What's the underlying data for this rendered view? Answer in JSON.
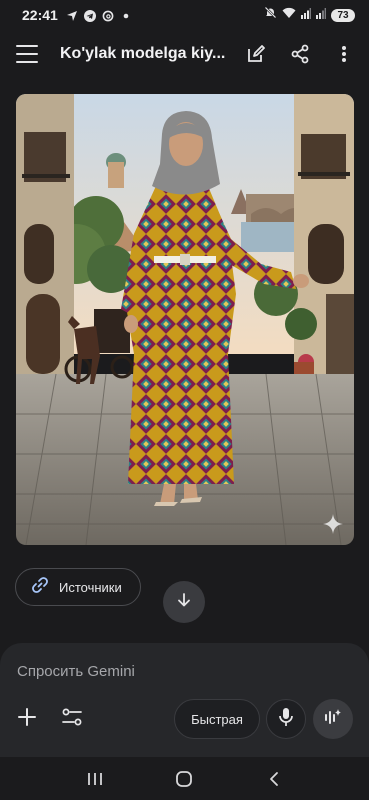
{
  "status_bar": {
    "time": "22:41",
    "battery": "73",
    "left_icons": [
      "location-arrow-icon",
      "telegram-icon",
      "threads-icon",
      "dot-icon"
    ],
    "right_icons": [
      "mute-icon",
      "wifi-icon",
      "signal-icon",
      "signal-icon",
      "battery-icon"
    ]
  },
  "app_bar": {
    "title": "Ko'ylak modelga kiy...",
    "icons": [
      "menu-icon",
      "edit-icon",
      "share-icon",
      "more-vert-icon"
    ]
  },
  "image": {
    "description_icon": "sparkle-icon"
  },
  "sources_chip": {
    "label": "Источники",
    "icon": "link-icon"
  },
  "input": {
    "placeholder": "Спросить Gemini",
    "model_label": "Быстрая"
  },
  "colors": {
    "background": "#1b1b1d",
    "panel": "#26272a",
    "text": "#e6e6e8",
    "link_accent": "#a8c7fa"
  }
}
